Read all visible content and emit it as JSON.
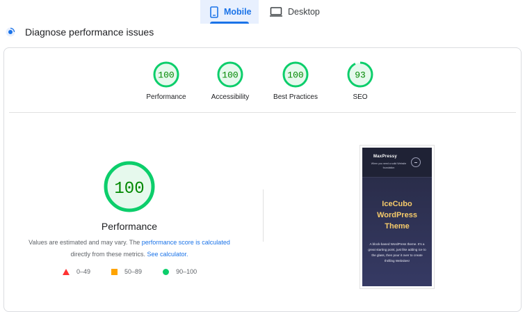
{
  "tabs": [
    {
      "label": "Mobile",
      "active": true,
      "icon": "phone-icon"
    },
    {
      "label": "Desktop",
      "active": false,
      "icon": "monitor-icon"
    }
  ],
  "diagnose": {
    "title": "Diagnose performance issues",
    "icon": "diagnose-icon"
  },
  "categories": [
    {
      "score": "100",
      "label": "Performance",
      "level": 1.0
    },
    {
      "score": "100",
      "label": "Accessibility",
      "level": 1.0
    },
    {
      "score": "100",
      "label": "Best Practices",
      "level": 1.0
    },
    {
      "score": "93",
      "label": "SEO",
      "level": 0.93
    }
  ],
  "main": {
    "score": "100",
    "label": "Performance",
    "note_prefix": "Values are estimated and may vary. The ",
    "note_link": "performance score is calculated",
    "note_mid": " directly from these metrics. ",
    "note_calc": "See calculator.",
    "legend": [
      {
        "range": "0–49",
        "shape": "triangle",
        "color": "#f33"
      },
      {
        "range": "50–89",
        "shape": "square",
        "color": "#ffa400"
      },
      {
        "range": "90–100",
        "shape": "circle",
        "color": "#0cce6b"
      }
    ]
  },
  "screenshot": {
    "logo": "MaxPressy",
    "tagline": "When you need a solid Website foundation",
    "title_line1": "IceCubo",
    "title_line2": "WordPress",
    "title_line3": "Theme",
    "body": "A block-based WordPress theme. It's a great starting point, just like adding ice to the glass, then pour it over to create thrilling Websites!"
  },
  "colors": {
    "pass": "#0cce6b",
    "pass_bg": "#e6f9ed",
    "pass_text": "#008800",
    "accent": "#1a73e8"
  }
}
